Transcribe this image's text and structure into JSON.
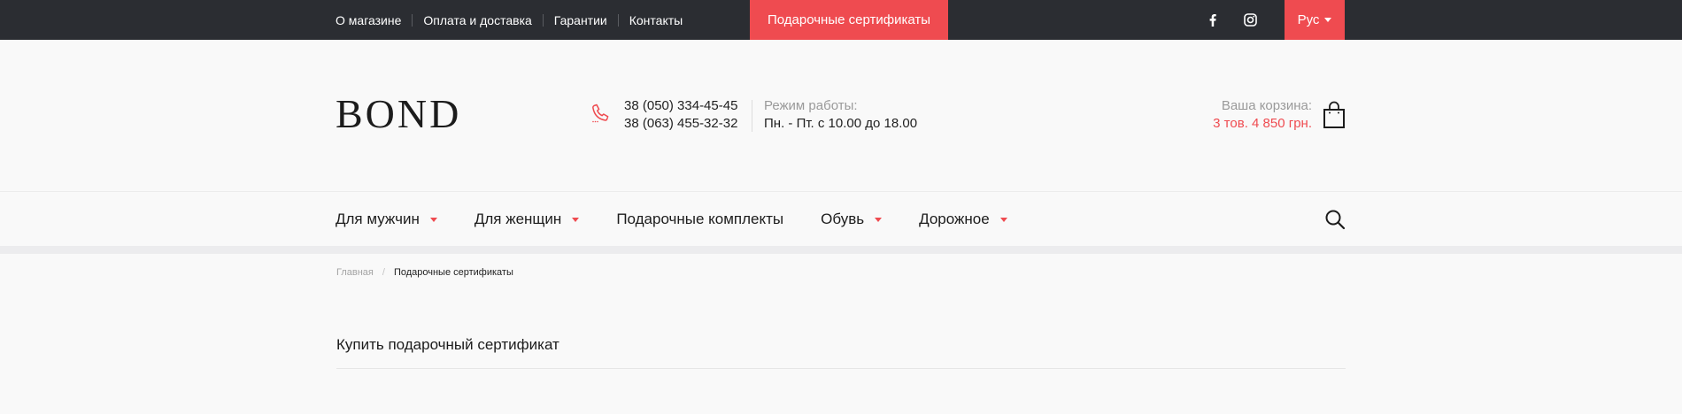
{
  "topbar": {
    "links": [
      "О магазине",
      "Оплата и доставка",
      "Гарантии",
      "Контакты"
    ],
    "gift_button": "Подарочные сертификаты",
    "social_icons": [
      "facebook-icon",
      "instagram-icon"
    ],
    "language": "Рус"
  },
  "header": {
    "logo": "BOND",
    "phones": [
      "38 (050) 334-45-45",
      "38 (063) 455-32-32"
    ],
    "hours_label": "Режим работы:",
    "hours_value": "Пн. - Пт. с 10.00 до 18.00",
    "cart_label": "Ваша корзина:",
    "cart_summary": "3 тов. 4 850 грн."
  },
  "nav": {
    "items": [
      {
        "label": "Для мужчин",
        "has_dropdown": true
      },
      {
        "label": "Для женщин",
        "has_dropdown": true
      },
      {
        "label": "Подарочные комплекты",
        "has_dropdown": false
      },
      {
        "label": "Обувь",
        "has_dropdown": true
      },
      {
        "label": "Дорожное",
        "has_dropdown": true
      }
    ],
    "search_icon": "search-icon"
  },
  "breadcrumb": {
    "home": "Главная",
    "separator": "/",
    "current": "Подарочные сертификаты"
  },
  "page": {
    "title": "Купить подарочный сертификат"
  },
  "colors": {
    "accent": "#ef4b50",
    "topbar": "#2b2d32",
    "background": "#f9f9f9"
  }
}
